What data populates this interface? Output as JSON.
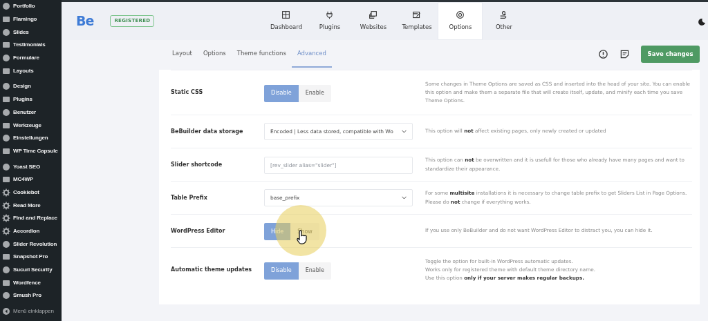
{
  "sidebar": {
    "groups": [
      [
        "Portfolio",
        "Flamingo",
        "Slides",
        "Testimonials",
        "Formulare",
        "Layouts"
      ],
      [
        "Design",
        "Plugins",
        "Benutzer",
        "Werkzeuge",
        "Einstellungen",
        "WP Time Capsule"
      ],
      [
        "Yoast SEO",
        "MC4WP",
        "Cookiebot",
        "Read More",
        "Find and Replace",
        "Accordion",
        "Slider Revolution",
        "Snapshot Pro",
        "Sucuri Security",
        "Wordfence",
        "Smush Pro"
      ]
    ],
    "collapse": "Menü einklappen"
  },
  "header": {
    "logo": "Be",
    "badge": "REGISTERED",
    "tabs": [
      {
        "label": "Dashboard",
        "selected": false
      },
      {
        "label": "Plugins",
        "selected": false
      },
      {
        "label": "Websites",
        "selected": false
      },
      {
        "label": "Templates",
        "selected": false
      },
      {
        "label": "Options",
        "selected": true
      },
      {
        "label": "Other",
        "selected": false
      }
    ]
  },
  "subtabs": [
    {
      "label": "Layout",
      "selected": false
    },
    {
      "label": "Options",
      "selected": false
    },
    {
      "label": "Theme functions",
      "selected": false
    },
    {
      "label": "Advanced",
      "selected": true
    }
  ],
  "save_button": "Save changes",
  "rows": [
    {
      "kind": "toggle",
      "label": "Static CSS",
      "options": [
        {
          "label": "Disable",
          "selected": true
        },
        {
          "label": "Enable",
          "selected": false
        }
      ],
      "description": "Some changes in Theme Options are saved as CSS and inserted into the head of your site. You can enable this option and make them a separate file that will create itself, update, and minify each time you save Theme Options."
    },
    {
      "kind": "select",
      "label": "BeBuilder data storage",
      "value": "Encoded | Less data stored, compatible with Wo",
      "description": "This option will **not** affect existing pages, only newly created or updated"
    },
    {
      "kind": "input",
      "label": "Slider shortcode",
      "placeholder": "[rev_slider alias=\"slider\"]",
      "description": "This option can **not** be overwritten and it is usefull for those who already have many pages and want to standardize their appearance."
    },
    {
      "kind": "select",
      "label": "Table Prefix",
      "value": "base_prefix",
      "description": "For some **multisite** installations it is necessary to change table prefix to get Sliders List in Page Options.\nPlease do **not** change if everything works."
    },
    {
      "kind": "toggle",
      "label": "WordPress Editor",
      "options": [
        {
          "label": "Hide",
          "selected": true
        },
        {
          "label": "Show",
          "selected": false
        }
      ],
      "description": "If you use only BeBuilder and do not want WordPress Editor to distract you, you can hide it."
    },
    {
      "kind": "toggle",
      "label": "Automatic theme updates",
      "options": [
        {
          "label": "Disable",
          "selected": true
        },
        {
          "label": "Enable",
          "selected": false
        }
      ],
      "description": "Toggle the option for built-in WordPress automatic updates.\nWorks only for registered theme with default theme directory name.\nUse this option **only if your server makes regular backups.**"
    }
  ]
}
